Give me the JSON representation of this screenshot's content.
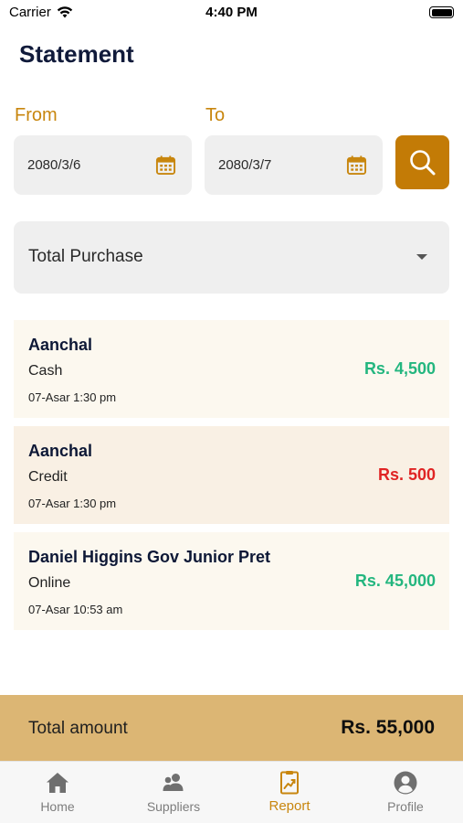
{
  "status": {
    "carrier": "Carrier",
    "time": "4:40 PM"
  },
  "header": {
    "title": "Statement"
  },
  "filters": {
    "from_label": "From",
    "from_value": "2080/3/6",
    "to_label": "To",
    "to_value": "2080/3/7",
    "type_selected": "Total Purchase"
  },
  "transactions": [
    {
      "name": "Aanchal",
      "method": "Cash",
      "time": "07-Asar 1:30 pm",
      "amount": "Rs. 4,500",
      "amount_color": "#23b67f",
      "bg": "#fcf8ef"
    },
    {
      "name": "Aanchal",
      "method": "Credit",
      "time": "07-Asar 1:30 pm",
      "amount": "Rs. 500",
      "amount_color": "#e02424",
      "bg": "#f9f0e4"
    },
    {
      "name": "Daniel Higgins Gov Junior Pret",
      "method": "Online",
      "time": "07-Asar 10:53 am",
      "amount": "Rs. 45,000",
      "amount_color": "#23b67f",
      "bg": "#fcf8ef"
    }
  ],
  "total": {
    "label": "Total amount",
    "value": "Rs. 55,000"
  },
  "tabs": [
    {
      "label": "Home",
      "icon": "home-icon",
      "active": false
    },
    {
      "label": "Suppliers",
      "icon": "suppliers-icon",
      "active": false
    },
    {
      "label": "Report",
      "icon": "report-icon",
      "active": true
    },
    {
      "label": "Profile",
      "icon": "profile-icon",
      "active": false
    }
  ],
  "colors": {
    "accent": "#c37b06",
    "label": "#c8860e",
    "credit_red": "#e02424",
    "cash_green": "#23b67f",
    "total_bg": "#dcb674"
  }
}
